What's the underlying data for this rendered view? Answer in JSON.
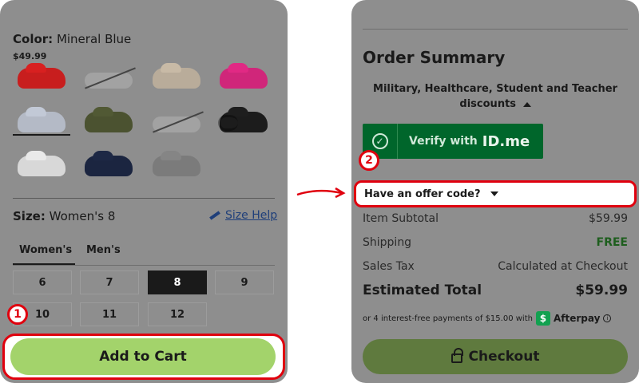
{
  "left": {
    "color_label": "Color:",
    "color_value": "Mineral Blue",
    "price": "$49.99",
    "swatches": [
      {
        "name": "red",
        "color": "#c81e1e",
        "available": true
      },
      {
        "name": "white-unavailable",
        "available": false
      },
      {
        "name": "bone",
        "color": "#b9ac9a",
        "available": true
      },
      {
        "name": "pink",
        "color": "#d0267a",
        "available": true
      },
      {
        "name": "mineral-blue",
        "color": "#b4bac6",
        "available": true,
        "selected": true
      },
      {
        "name": "army-green",
        "color": "#4b5230",
        "available": true
      },
      {
        "name": "white-unavailable-2",
        "available": false
      },
      {
        "name": "black",
        "color": "#1c1c1c",
        "available": true
      },
      {
        "name": "white",
        "color": "#d8d8d8",
        "available": true
      },
      {
        "name": "navy",
        "color": "#1b2540",
        "available": true
      },
      {
        "name": "slate-grey",
        "color": "#7b7b7b",
        "available": true
      }
    ],
    "size_label": "Size:",
    "size_value": "Women's 8",
    "size_help": "Size Help",
    "tabs": [
      "Women's",
      "Men's"
    ],
    "sizes": [
      "6",
      "7",
      "8",
      "9",
      "10",
      "11",
      "12"
    ],
    "selected_size": "8",
    "add_to_cart": "Add to Cart",
    "badge": "1"
  },
  "right": {
    "title": "Order Summary",
    "discounts": "Military, Healthcare, Student and Teacher discounts",
    "verify_text": "Verify with",
    "verify_brand": "ID.me",
    "offer_code": "Have an offer code?",
    "badge": "2",
    "rows": [
      {
        "label": "Item Subtotal",
        "value": "$59.99"
      },
      {
        "label": "Shipping",
        "value": "FREE"
      },
      {
        "label": "Sales Tax",
        "value": "Calculated at Checkout"
      }
    ],
    "total_label": "Estimated Total",
    "total_value": "$59.99",
    "afterpay_text": "or 4 interest-free payments of $15.00 with",
    "afterpay_brand": "Afterpay",
    "checkout": "Checkout"
  },
  "colors": {
    "highlight": "#e0000e",
    "cart_green": "#a3d36b",
    "idme_green": "#00662b",
    "overlay": "#8e8e8e"
  }
}
